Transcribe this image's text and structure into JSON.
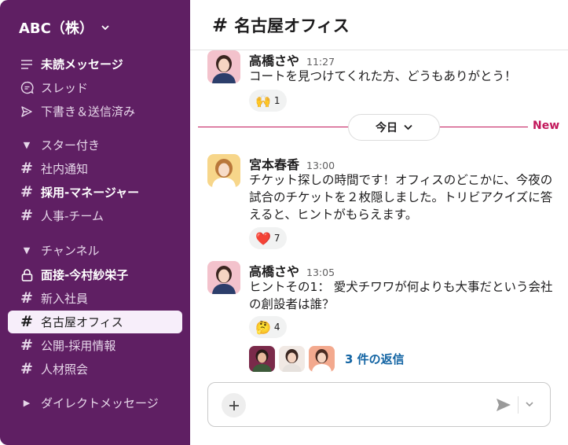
{
  "workspace": {
    "name": "ABC（株）"
  },
  "sidebar": {
    "items": [
      {
        "label": "未読メッセージ",
        "icon": "unread-icon"
      },
      {
        "label": "スレッド",
        "icon": "threads-icon"
      },
      {
        "label": "下書き＆送信済み",
        "icon": "send-icon"
      },
      {
        "label": "スター付き",
        "icon": "caret-down-icon"
      },
      {
        "label": "社内通知",
        "icon": "hash-icon"
      },
      {
        "label": "採用-マネージャー",
        "icon": "hash-icon"
      },
      {
        "label": "人事-チーム",
        "icon": "hash-icon"
      },
      {
        "label": "チャンネル",
        "icon": "caret-down-icon"
      },
      {
        "label": "面接-今村紗栄子",
        "icon": "lock-icon"
      },
      {
        "label": "新入社員",
        "icon": "hash-icon"
      },
      {
        "label": "名古屋オフィス",
        "icon": "hash-icon"
      },
      {
        "label": "公開-採用情報",
        "icon": "hash-icon"
      },
      {
        "label": "人材照会",
        "icon": "hash-icon"
      },
      {
        "label": "ダイレクトメッセージ",
        "icon": "caret-right-icon"
      }
    ]
  },
  "channel": {
    "hash": "#",
    "title": "名古屋オフィス"
  },
  "messages": [
    {
      "name": "高橋さや",
      "time": "11:27",
      "text": "コートを見つけてくれた方、どうもありがとう！",
      "reaction": {
        "emoji": "🙌",
        "count": "1"
      }
    },
    {
      "name": "宮本春香",
      "time": "13:00",
      "text": "チケット探しの時間です！オフィスのどこかに、今夜の試合のチケットを２枚隠しました。トリビアクイズに答えると、ヒントがもらえます。",
      "reaction": {
        "emoji": "❤️",
        "count": "7"
      }
    },
    {
      "name": "高橋さや",
      "time": "13:05",
      "text": "ヒントその1： 愛犬チワワが何よりも大事だという会社の創設者は誰？",
      "reaction": {
        "emoji": "🤔",
        "count": "4"
      }
    }
  ],
  "divider": {
    "day": "今日",
    "new_label": "New"
  },
  "thread": {
    "replies": "3 件の返信"
  },
  "composer": {
    "placeholder": ""
  },
  "colors": {
    "sidebar": "#5f1f63",
    "accent_new": "#c2185b",
    "link": "#1264a3"
  }
}
